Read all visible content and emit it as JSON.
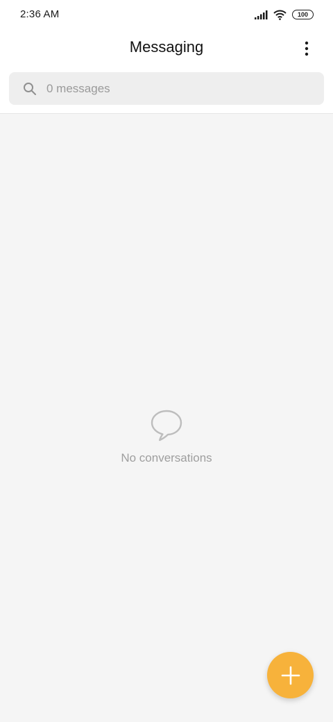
{
  "status_bar": {
    "time": "2:36 AM",
    "battery": "100",
    "icons": [
      "signal-icon",
      "wifi-icon",
      "battery-icon"
    ]
  },
  "app_bar": {
    "title": "Messaging",
    "menu_icon": "more-vert-icon"
  },
  "search": {
    "placeholder": "0 messages",
    "value": "",
    "icon": "search-icon"
  },
  "empty_state": {
    "icon": "chat-bubble-icon",
    "message": "No conversations"
  },
  "fab": {
    "icon": "plus-icon",
    "color": "#f7b23b"
  },
  "colors": {
    "accent": "#f7b23b",
    "background": "#f5f5f5",
    "header": "#ffffff",
    "search_field": "#eeeeee"
  }
}
